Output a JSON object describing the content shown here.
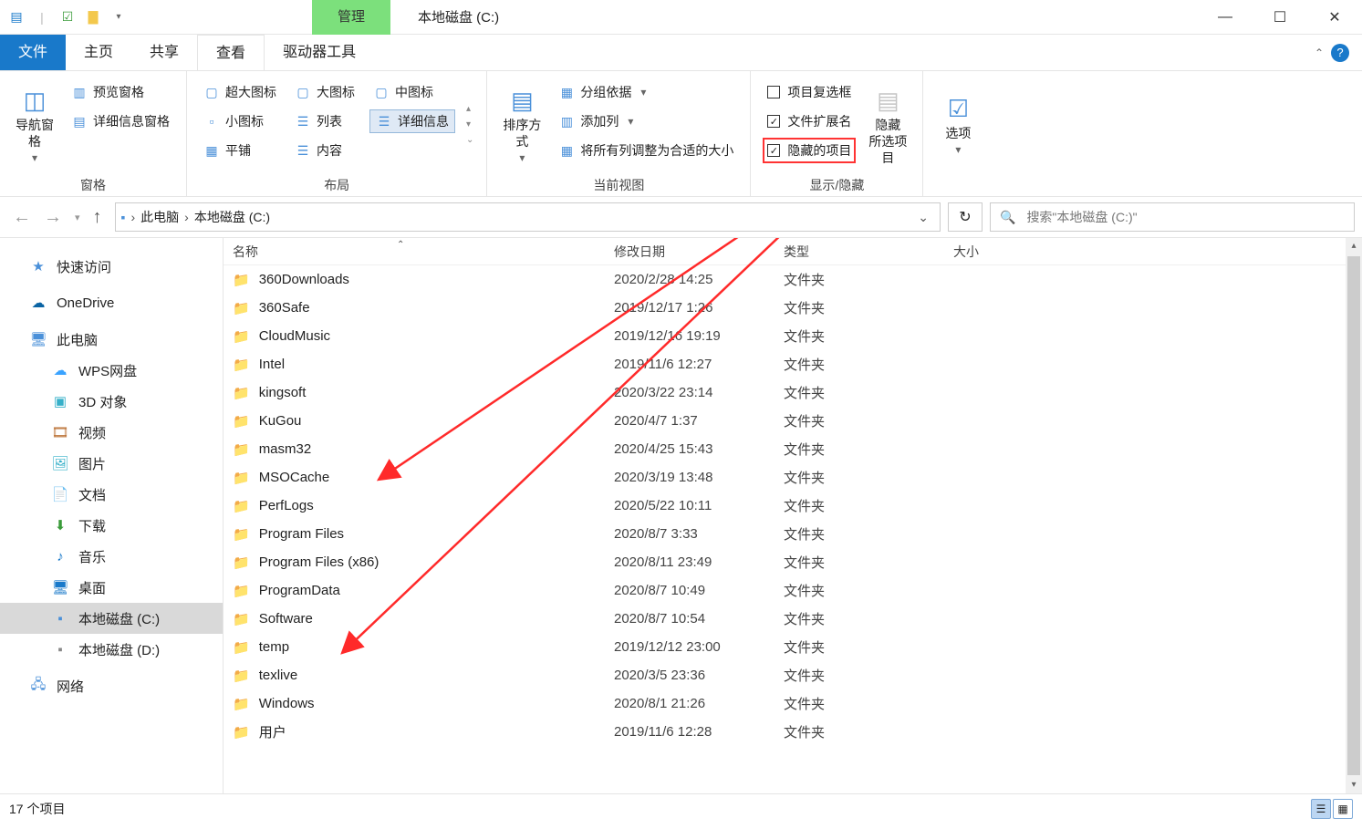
{
  "window": {
    "title": "本地磁盘 (C:)",
    "manage_tab": "管理",
    "controls": {
      "min": "—",
      "max": "☐",
      "close": "✕"
    }
  },
  "tabs": {
    "file": "文件",
    "home": "主页",
    "share": "共享",
    "view": "查看",
    "drive_tools": "驱动器工具"
  },
  "ribbon": {
    "pane_group": "窗格",
    "nav_pane": "导航窗格",
    "preview_pane": "预览窗格",
    "details_pane": "详细信息窗格",
    "layout_group": "布局",
    "xl_icons": "超大图标",
    "l_icons": "大图标",
    "m_icons": "中图标",
    "s_icons": "小图标",
    "list": "列表",
    "details": "详细信息",
    "tiles": "平铺",
    "content": "内容",
    "current_view_group": "当前视图",
    "sort_by": "排序方式",
    "group_by": "分组依据",
    "add_columns": "添加列",
    "size_all": "将所有列调整为合适的大小",
    "show_hide_group": "显示/隐藏",
    "item_checkboxes": "项目复选框",
    "file_ext": "文件扩展名",
    "hidden_items": "隐藏的项目",
    "hide_selected": "隐藏",
    "hide_selected2": "所选项目",
    "options": "选项"
  },
  "address": {
    "this_pc": "此电脑",
    "drive": "本地磁盘 (C:)"
  },
  "search": {
    "placeholder": "搜索\"本地磁盘 (C:)\""
  },
  "columns": {
    "name": "名称",
    "date": "修改日期",
    "type": "类型",
    "size": "大小"
  },
  "nav": {
    "quick_access": "快速访问",
    "onedrive": "OneDrive",
    "this_pc": "此电脑",
    "wps": "WPS网盘",
    "obj3d": "3D 对象",
    "videos": "视频",
    "pictures": "图片",
    "documents": "文档",
    "downloads": "下载",
    "music": "音乐",
    "desktop": "桌面",
    "drive_c": "本地磁盘 (C:)",
    "drive_d": "本地磁盘 (D:)",
    "network": "网络"
  },
  "files": [
    {
      "name": "360Downloads",
      "date": "2020/2/28 14:25",
      "type": "文件夹",
      "hidden": false
    },
    {
      "name": "360Safe",
      "date": "2019/12/17 1:26",
      "type": "文件夹",
      "hidden": false
    },
    {
      "name": "CloudMusic",
      "date": "2019/12/16 19:19",
      "type": "文件夹",
      "hidden": false
    },
    {
      "name": "Intel",
      "date": "2019/11/6 12:27",
      "type": "文件夹",
      "hidden": false
    },
    {
      "name": "kingsoft",
      "date": "2020/3/22 23:14",
      "type": "文件夹",
      "hidden": false
    },
    {
      "name": "KuGou",
      "date": "2020/4/7 1:37",
      "type": "文件夹",
      "hidden": false
    },
    {
      "name": "masm32",
      "date": "2020/4/25 15:43",
      "type": "文件夹",
      "hidden": false
    },
    {
      "name": "MSOCache",
      "date": "2020/3/19 13:48",
      "type": "文件夹",
      "hidden": true
    },
    {
      "name": "PerfLogs",
      "date": "2020/5/22 10:11",
      "type": "文件夹",
      "hidden": false
    },
    {
      "name": "Program Files",
      "date": "2020/8/7 3:33",
      "type": "文件夹",
      "hidden": false
    },
    {
      "name": "Program Files (x86)",
      "date": "2020/8/11 23:49",
      "type": "文件夹",
      "hidden": false
    },
    {
      "name": "ProgramData",
      "date": "2020/8/7 10:49",
      "type": "文件夹",
      "hidden": true
    },
    {
      "name": "Software",
      "date": "2020/8/7 10:54",
      "type": "文件夹",
      "hidden": false
    },
    {
      "name": "temp",
      "date": "2019/12/12 23:00",
      "type": "文件夹",
      "hidden": false
    },
    {
      "name": "texlive",
      "date": "2020/3/5 23:36",
      "type": "文件夹",
      "hidden": false
    },
    {
      "name": "Windows",
      "date": "2020/8/1 21:26",
      "type": "文件夹",
      "hidden": false
    },
    {
      "name": "用户",
      "date": "2019/11/6 12:28",
      "type": "文件夹",
      "hidden": false
    }
  ],
  "status": {
    "count": "17 个项目"
  }
}
